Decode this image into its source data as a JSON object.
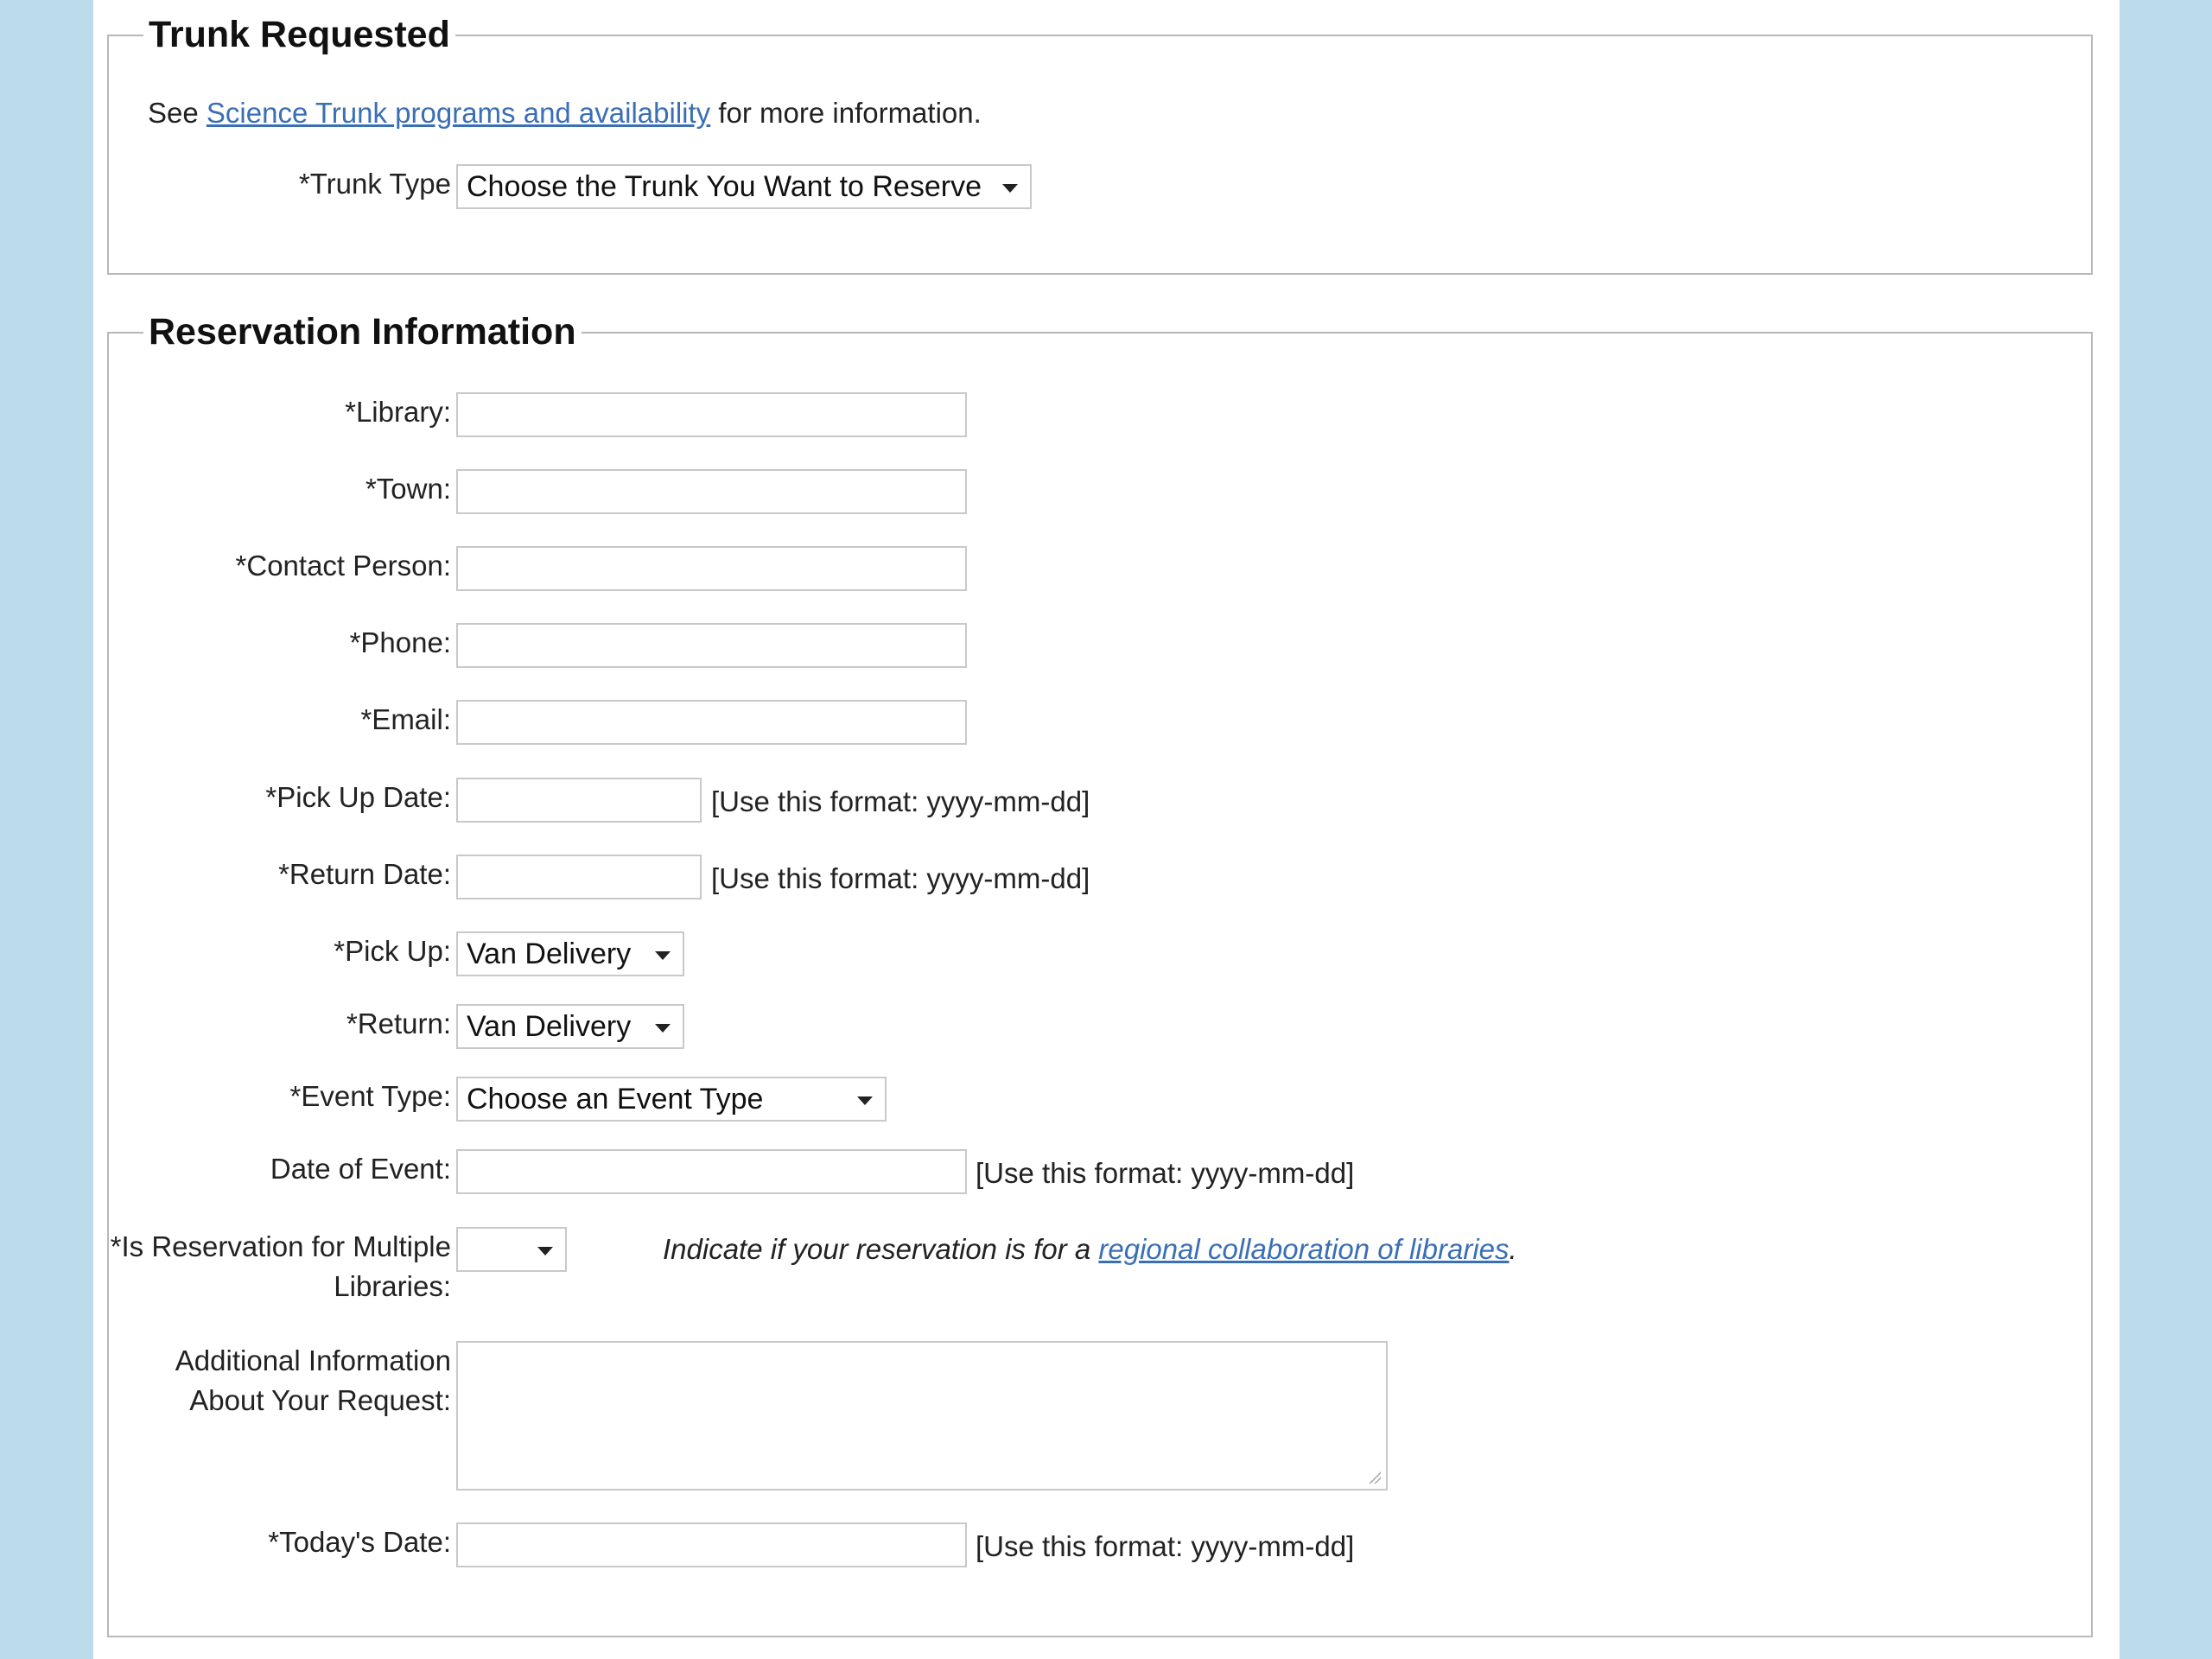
{
  "trunk_section": {
    "legend": "Trunk Requested",
    "info_prefix": "See ",
    "info_link": "Science Trunk programs and availability",
    "info_suffix": " for more information.",
    "trunk_type_label": "*Trunk Type",
    "trunk_type_value": "Choose the Trunk You Want to Reserve"
  },
  "reservation": {
    "legend": "Reservation Information",
    "library_label": "*Library:",
    "town_label": "*Town:",
    "contact_label": "*Contact Person:",
    "phone_label": "*Phone:",
    "email_label": "*Email:",
    "pickup_date_label": "*Pick Up Date:",
    "return_date_label": "*Return Date:",
    "pickup_label": "*Pick Up:",
    "pickup_value": "Van Delivery",
    "return_label": "*Return:",
    "return_value": "Van Delivery",
    "event_type_label": "*Event Type:",
    "event_type_value": "Choose an Event Type",
    "event_date_label": "Date of Event:",
    "multi_label": "*Is Reservation for Multiple Libraries:",
    "multi_value": "",
    "multi_hint_prefix": "Indicate if your reservation is for a ",
    "multi_hint_link": "regional collaboration of libraries",
    "multi_hint_suffix": ".",
    "additional_label": "Additional Information About Your Request:",
    "todays_date_label": "*Today's Date:",
    "date_format_hint": "[Use this format: yyyy-mm-dd]"
  }
}
